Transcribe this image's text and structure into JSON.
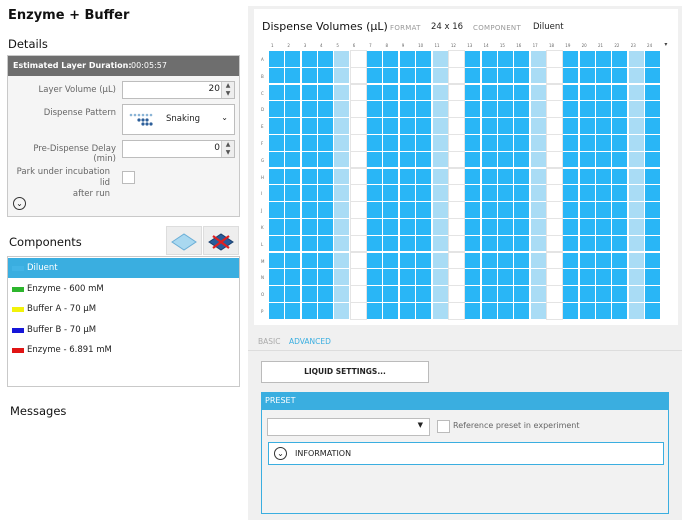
{
  "title": "Enzyme + Buffer",
  "details": {
    "heading": "Details",
    "duration_label": "Estimated Layer Duration:",
    "duration_value": "00:05:57",
    "layer_volume_label": "Layer Volume (µL)",
    "layer_volume_value": "20",
    "dispense_pattern_label": "Dispense Pattern",
    "dispense_pattern_value": "Snaking",
    "pre_dispense_label": "Pre-Dispense Delay (min)",
    "pre_dispense_value": "0",
    "park_label_1": "Park under incubation lid",
    "park_label_2": "after run"
  },
  "components": {
    "heading": "Components",
    "items": [
      {
        "name": "Diluent",
        "color": "#42b4e6",
        "selected": true
      },
      {
        "name": "Enzyme - 600 mM",
        "color": "#2db52d",
        "selected": false
      },
      {
        "name": "Buffer A - 70 µM",
        "color": "#f2f20a",
        "selected": false
      },
      {
        "name": "Buffer B - 70 µM",
        "color": "#1616d8",
        "selected": false
      },
      {
        "name": "Enzyme - 6.891 mM",
        "color": "#e01414",
        "selected": false
      }
    ]
  },
  "messages": {
    "heading": "Messages"
  },
  "plate": {
    "title": "Dispense Volumes (µL)",
    "format_label": "FORMAT",
    "format_value": "24 x 16",
    "component_label": "COMPONENT",
    "component_value": "Diluent",
    "columns": [
      "1",
      "2",
      "3",
      "4",
      "5",
      "6",
      "7",
      "8",
      "9",
      "10",
      "11",
      "12",
      "13",
      "14",
      "15",
      "16",
      "17",
      "18",
      "19",
      "20",
      "21",
      "22",
      "23",
      "24"
    ],
    "rows": [
      "A",
      "B",
      "C",
      "D",
      "E",
      "F",
      "G",
      "H",
      "I",
      "J",
      "K",
      "L",
      "M",
      "N",
      "O",
      "P"
    ],
    "empty_columns": [
      6,
      12,
      18
    ],
    "pale_columns": [
      5,
      11,
      17,
      23
    ],
    "well_color": "#29b6f6",
    "pale_color": "#a9dcf5"
  },
  "tabs": {
    "basic": "BASIC",
    "advanced": "ADVANCED"
  },
  "liquid_settings_button": "LIQUID SETTINGS...",
  "preset": {
    "heading": "PRESET",
    "select_value": "",
    "reference_label": "Reference preset in experiment",
    "information_label": "INFORMATION"
  }
}
